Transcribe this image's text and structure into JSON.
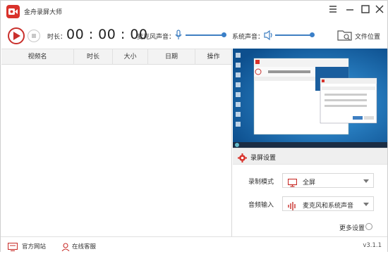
{
  "app": {
    "title": "金舟录屏大师"
  },
  "toolbar": {
    "duration_label": "时长：",
    "timer": "00 : 00 : 00",
    "mic_label": "麦克风声音：",
    "mic_level": 0.93,
    "system_label": "系统声音：",
    "system_level": 0.9,
    "folder_label": "文件位置"
  },
  "list": {
    "columns": [
      "视频名",
      "时长",
      "大小",
      "日期",
      "操作"
    ]
  },
  "settings": {
    "title": "录屏设置",
    "mode_label": "录制模式",
    "mode_value": "全屏",
    "audio_label": "音频输入",
    "audio_value": "麦克风和系统声音",
    "more_label": "更多设置"
  },
  "footer": {
    "website_label": "官方网站",
    "service_label": "在线客服",
    "version": "v3.1.1"
  },
  "colors": {
    "accent_red": "#d9322b",
    "slider_blue": "#3f7fc2",
    "desktop_blue": "#1d6fb4"
  }
}
